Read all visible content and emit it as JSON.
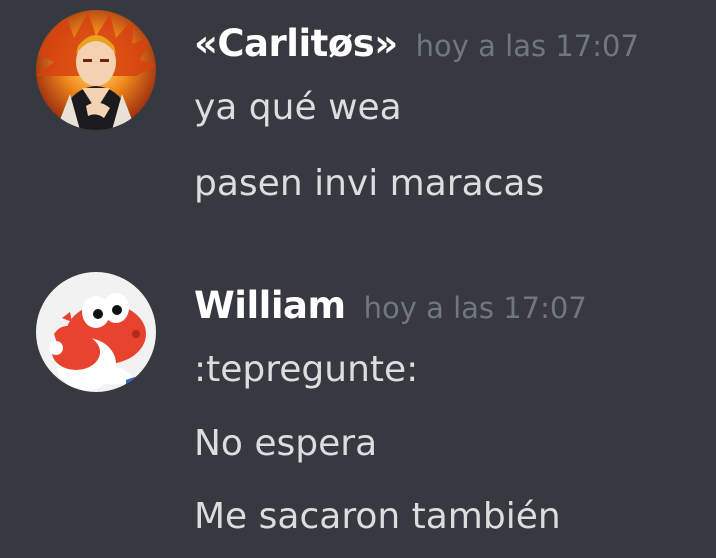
{
  "messages": [
    {
      "username": "«Carlitøs»",
      "timestamp": "hoy a las 17:07",
      "avatar_icon": "anime-fire-character-avatar",
      "lines": [
        "ya qué wea",
        "pasen invi maracas"
      ]
    },
    {
      "username": "William",
      "timestamp": "hoy a las 17:07",
      "avatar_icon": "red-yoshi-avatar",
      "lines": [
        ":tepregunte:",
        "No espera",
        "Me sacaron también"
      ]
    }
  ],
  "colors": {
    "background": "#36393f",
    "username": "#ffffff",
    "timestamp": "#72767d",
    "message_text": "#dcddde"
  }
}
